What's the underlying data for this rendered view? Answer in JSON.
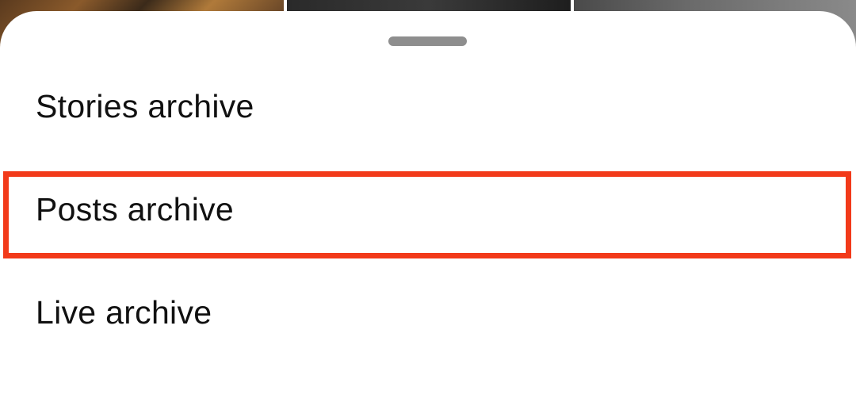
{
  "background": {
    "tiles": [
      "photo-thumbnail",
      "photo-thumbnail",
      "photo-thumbnail"
    ]
  },
  "sheet": {
    "menu": {
      "items": [
        {
          "label": "Stories archive"
        },
        {
          "label": "Posts archive"
        },
        {
          "label": "Live archive"
        }
      ]
    },
    "highlight": {
      "color": "#f23a1a",
      "target": "Posts archive"
    }
  }
}
